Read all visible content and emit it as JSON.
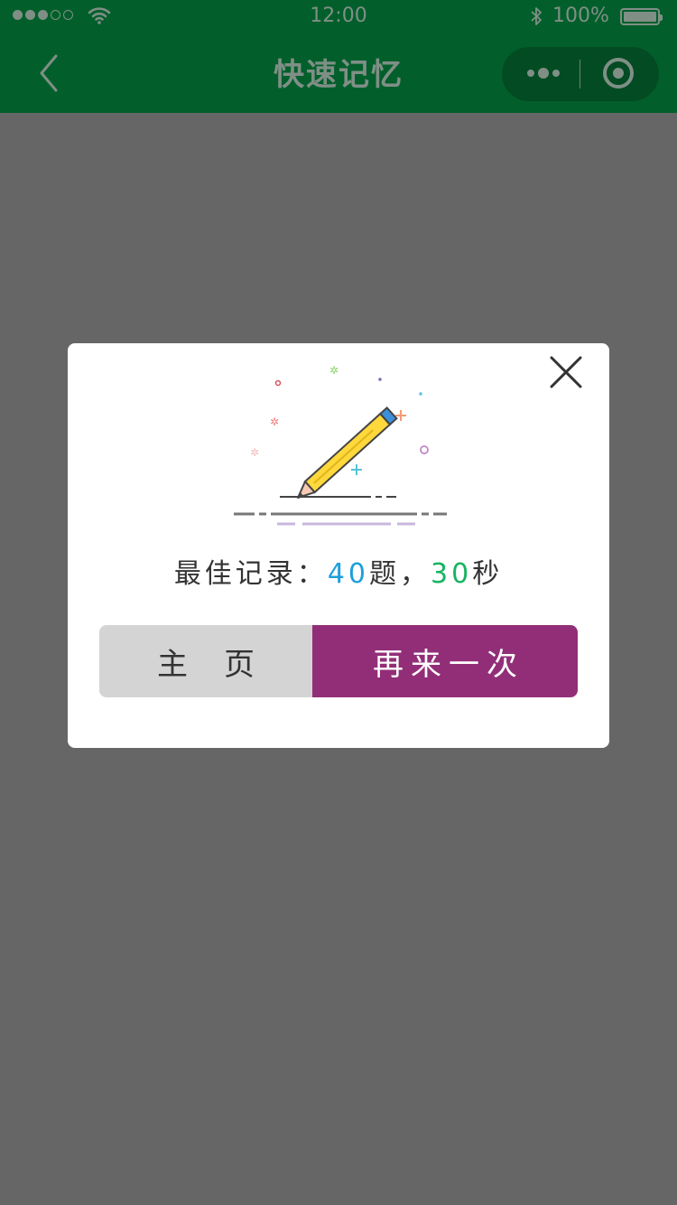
{
  "status_bar": {
    "time": "12:00",
    "battery": "100%"
  },
  "nav": {
    "title": "快速记忆"
  },
  "modal": {
    "record_label": "最佳记录：",
    "questions_value": "40",
    "questions_unit": "题，",
    "seconds_value": "30",
    "seconds_unit": "秒",
    "home_label": "主页",
    "retry_label": "再来一次"
  },
  "colors": {
    "nav_bg": "#025f2b",
    "overlay": "#666666",
    "questions_color": "#1e9fdc",
    "seconds_color": "#16b460",
    "retry_bg": "#922e78",
    "home_bg": "#d4d4d4"
  }
}
